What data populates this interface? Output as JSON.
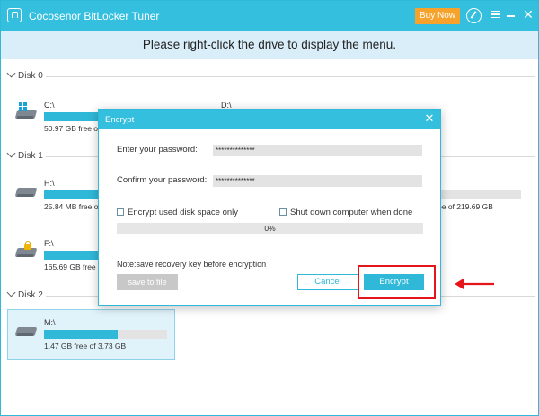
{
  "app": {
    "title": "Cocosenor BitLocker Tuner",
    "buy_now_label": "Buy Now",
    "icons": [
      "app-logo-icon",
      "key-icon",
      "menu-icon",
      "minimize-icon",
      "close-icon"
    ]
  },
  "banner": {
    "text": "Please right-click the drive to display the menu."
  },
  "disks": [
    {
      "label": "Disk 0",
      "drives": [
        {
          "name": "C:\\",
          "info": "50.97 GB free of",
          "used_fraction": 0.45,
          "icon": "windows-drive-icon"
        },
        {
          "name": "D:\\",
          "info": "",
          "used_fraction": null,
          "icon": "drive-icon"
        }
      ]
    },
    {
      "label": "Disk 1",
      "drives": [
        {
          "name": "H:\\",
          "info": "25.84 MB free of",
          "used_fraction": 1.0,
          "icon": "drive-icon"
        },
        {
          "name": "",
          "info": "ee of 219.69 GB",
          "used_fraction": 0.0,
          "icon": ""
        },
        {
          "name": "F:\\",
          "info": "165.69 GB free of",
          "used_fraction": 0.45,
          "icon": "locked-drive-icon"
        }
      ]
    },
    {
      "label": "Disk 2",
      "drives": [
        {
          "name": "M:\\",
          "info": "1.47 GB free of 3.73 GB",
          "used_fraction": 0.6,
          "icon": "drive-icon"
        }
      ]
    }
  ],
  "dialog": {
    "title": "Encrypt",
    "password_label": "Enter your password:",
    "password_value": "**************",
    "confirm_label": "Confirm your password:",
    "confirm_value": "**************",
    "checkbox_used_space": {
      "label": "Encrypt used disk space only",
      "checked": false
    },
    "checkbox_shutdown": {
      "label": "Shut down computer when done",
      "checked": false
    },
    "progress_text": "0%",
    "progress_value": 0,
    "note": "Note:save recovery key before encryption",
    "save_file_label": "save to file",
    "cancel_label": "Cancel",
    "encrypt_label": "Encrypt"
  },
  "colors": {
    "accent": "#34bfdf",
    "buy_now": "#f7a32b",
    "banner": "#d9eef9",
    "highlight": "#e4161b"
  }
}
